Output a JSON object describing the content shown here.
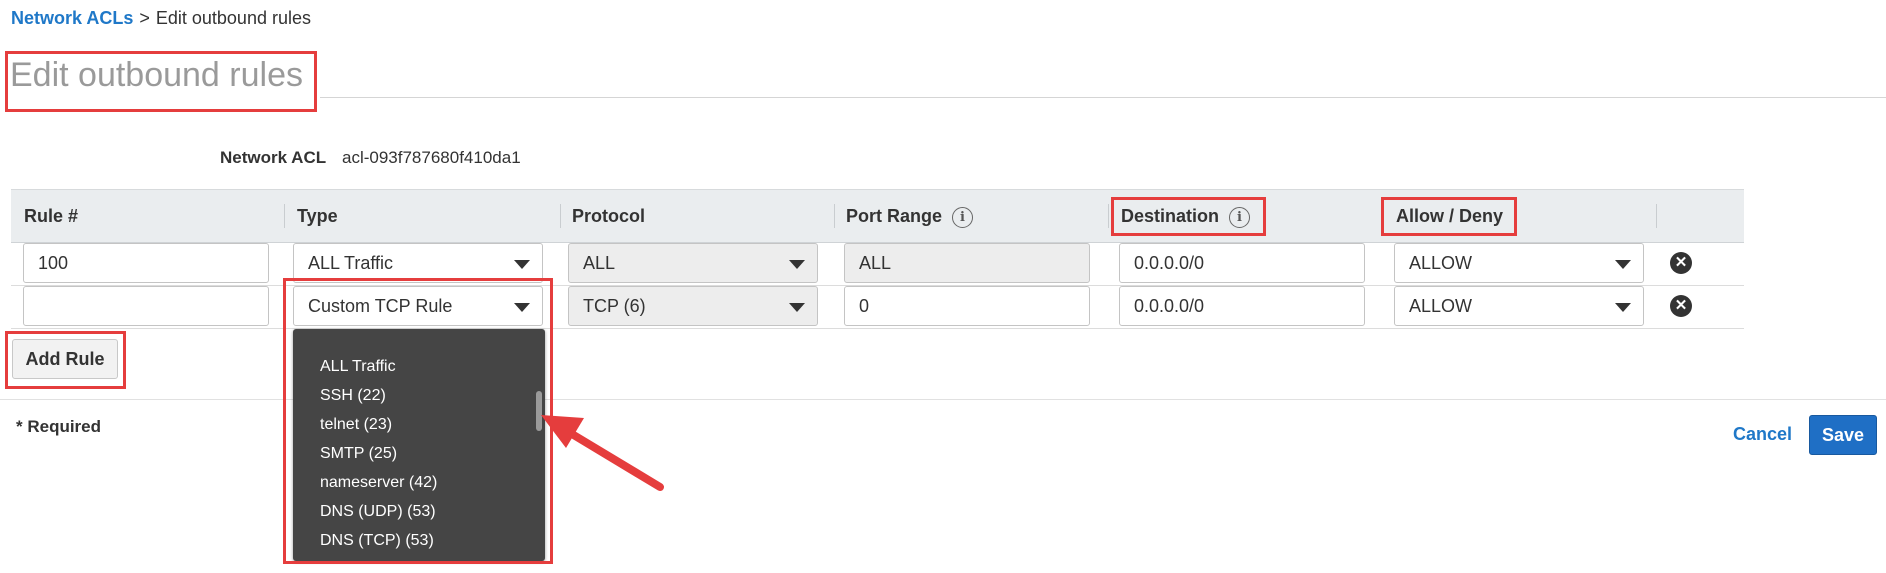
{
  "breadcrumb": {
    "parent": "Network ACLs",
    "separator": ">",
    "current": "Edit outbound rules"
  },
  "page_title": "Edit outbound rules",
  "network_acl": {
    "label": "Network ACL",
    "value": "acl-093f787680f410da1"
  },
  "table": {
    "headers": {
      "rule": "Rule #",
      "type": "Type",
      "protocol": "Protocol",
      "port_range": "Port Range",
      "destination": "Destination",
      "allow_deny": "Allow / Deny"
    },
    "info_icon": "i",
    "rows": [
      {
        "rule": "100",
        "type": "ALL Traffic",
        "protocol": "ALL",
        "port_range": "ALL",
        "destination": "0.0.0.0/0",
        "allow_deny": "ALLOW"
      },
      {
        "rule": "",
        "type": "Custom TCP Rule",
        "protocol": "TCP (6)",
        "port_range": "0",
        "destination": "0.0.0.0/0",
        "allow_deny": "ALLOW"
      }
    ]
  },
  "delete_icon_glyph": "✕",
  "buttons": {
    "add_rule": "Add Rule",
    "cancel": "Cancel",
    "save": "Save"
  },
  "required_note": "* Required",
  "type_dropdown": {
    "options": [
      "ALL Traffic",
      "SSH (22)",
      "telnet (23)",
      "SMTP (25)",
      "nameserver (42)",
      "DNS (UDP) (53)",
      "DNS (TCP) (53)"
    ]
  },
  "colors": {
    "accent": "#1f78c8",
    "save_button": "#1f6fc5",
    "annotation": "#e53d3d",
    "dropdown_bg": "#454545"
  },
  "icons": [
    "info-icon",
    "remove-icon",
    "chevron-down-icon",
    "annotation-arrow"
  ]
}
